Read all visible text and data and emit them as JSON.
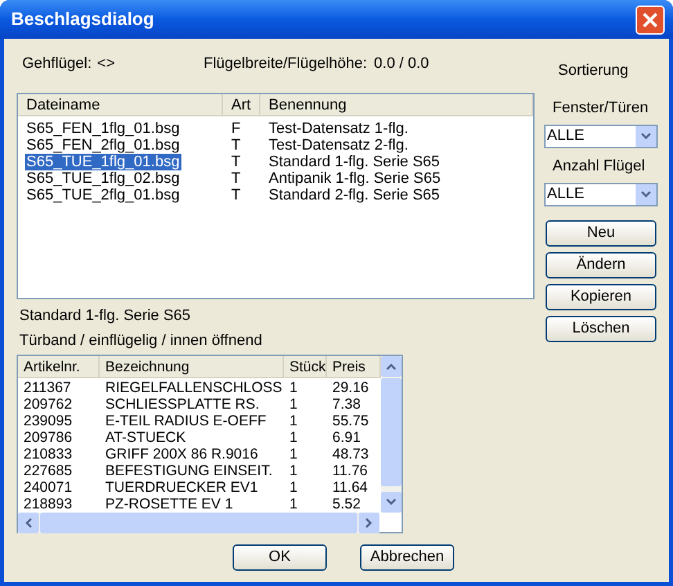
{
  "window": {
    "title": "Beschlagsdialog"
  },
  "gehfluegel": {
    "label": "Gehflügel:",
    "value": "<>"
  },
  "fluegelmasse": {
    "label": "Flügelbreite/Flügelhöhe:",
    "value": "0.0 / 0.0"
  },
  "file_list": {
    "columns": [
      "Dateiname",
      "Art",
      "Benennung"
    ],
    "rows": [
      {
        "cells": [
          "S65_FEN_1flg_01.bsg",
          "F",
          "Test-Datensatz 1-flg."
        ],
        "selected": false
      },
      {
        "cells": [
          "S65_FEN_2flg_01.bsg",
          "T",
          "Test-Datensatz 2-flg."
        ],
        "selected": false
      },
      {
        "cells": [
          "S65_TUE_1flg_01.bsg",
          "T",
          "Standard 1-flg. Serie S65"
        ],
        "selected": true
      },
      {
        "cells": [
          "S65_TUE_1flg_02.bsg",
          "T",
          "Antipanik 1-flg. Serie S65"
        ],
        "selected": false
      },
      {
        "cells": [
          "S65_TUE_2flg_01.bsg",
          "T",
          "Standard 2-flg. Serie S65"
        ],
        "selected": false
      }
    ]
  },
  "sidebar": {
    "heading": "Sortierung",
    "filters": [
      {
        "label": "Fenster/Türen",
        "value": "ALLE"
      },
      {
        "label": "Anzahl Flügel",
        "value": "ALLE"
      }
    ],
    "buttons": [
      "Neu",
      "Ändern",
      "Kopieren",
      "Löschen"
    ]
  },
  "selection_title": "Standard 1-flg. Serie S65",
  "selection_description": "Türband / einflügelig / innen öffnend",
  "parts_table": {
    "columns": [
      "Artikelnr.",
      "Bezeichnung",
      "Stück",
      "Preis"
    ],
    "rows": [
      [
        "211367",
        "RIEGELFALLENSCHLOSS",
        "1",
        "29.16"
      ],
      [
        "209762",
        "SCHLIESSPLATTE RS.",
        "1",
        "7.38"
      ],
      [
        "239095",
        "E-TEIL RADIUS E-OEFF",
        "1",
        "55.75"
      ],
      [
        "209786",
        "AT-STUECK",
        "1",
        "6.91"
      ],
      [
        "210833",
        "GRIFF 200X 86 R.9016",
        "1",
        "48.73"
      ],
      [
        "227685",
        "BEFESTIGUNG EINSEIT.",
        "1",
        "11.76"
      ],
      [
        "240071",
        "TUERDRUECKER EV1",
        "1",
        "11.64"
      ],
      [
        "218893",
        "PZ-ROSETTE EV 1",
        "1",
        "5.52"
      ]
    ]
  },
  "footer_buttons": [
    "OK",
    "Abbrechen"
  ]
}
